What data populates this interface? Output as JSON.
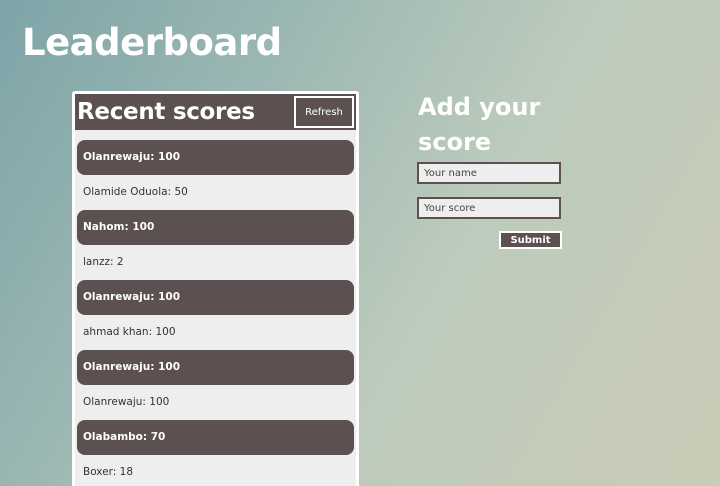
{
  "page": {
    "title": "Leaderboard"
  },
  "scores_panel": {
    "title": "Recent scores",
    "refresh_label": "Refresh",
    "scores": [
      "Olanrewaju: 100",
      "Olamide Oduola: 50",
      "Nahom: 100",
      "lanzz: 2",
      "Olanrewaju: 100",
      "ahmad khan: 100",
      "Olanrewaju: 100",
      "Olanrewaju: 100",
      "Olabambo: 70",
      "Boxer: 18"
    ]
  },
  "add_form": {
    "title": "Add your score",
    "name_placeholder": "Your name",
    "score_placeholder": "Your score",
    "submit_label": "Submit"
  },
  "colors": {
    "accent_dark": "#5d5050",
    "row_light": "#eeeeee",
    "text_white": "#ffffff"
  }
}
